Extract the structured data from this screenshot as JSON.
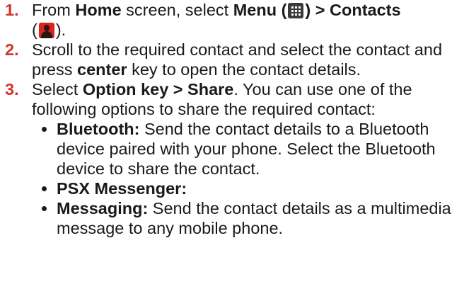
{
  "steps": [
    {
      "number": "1.",
      "parts": {
        "a": "From ",
        "b": "Home",
        "c": " screen, select ",
        "d": "Menu (",
        "e": ") > Contacts",
        "f": "(",
        "g": ")."
      }
    },
    {
      "number": "2.",
      "parts": {
        "a": "Scroll to the required contact and select the contact and press ",
        "b": "center",
        "c": " key to open the contact details."
      }
    },
    {
      "number": "3.",
      "parts": {
        "a": "Select ",
        "b": "Option key > Share",
        "c": ". You can use one of the following options to share the required contact:"
      },
      "bullets": [
        {
          "term": "Bluetooth:",
          "text": " Send the contact details to a Bluetooth device paired with your phone. Select the Bluetooth device to share the contact."
        },
        {
          "term": "PSX Messenger:",
          "text": ""
        },
        {
          "term": "Messaging:",
          "text": " Send the contact details as a multimedia message to any mobile phone."
        }
      ]
    }
  ],
  "icons": {
    "menu": "menu-grid-icon",
    "contacts": "contacts-person-icon",
    "menu_color": "#3a3a3a",
    "contacts_color": "#d8231f",
    "step_number_color": "#d2322d"
  }
}
